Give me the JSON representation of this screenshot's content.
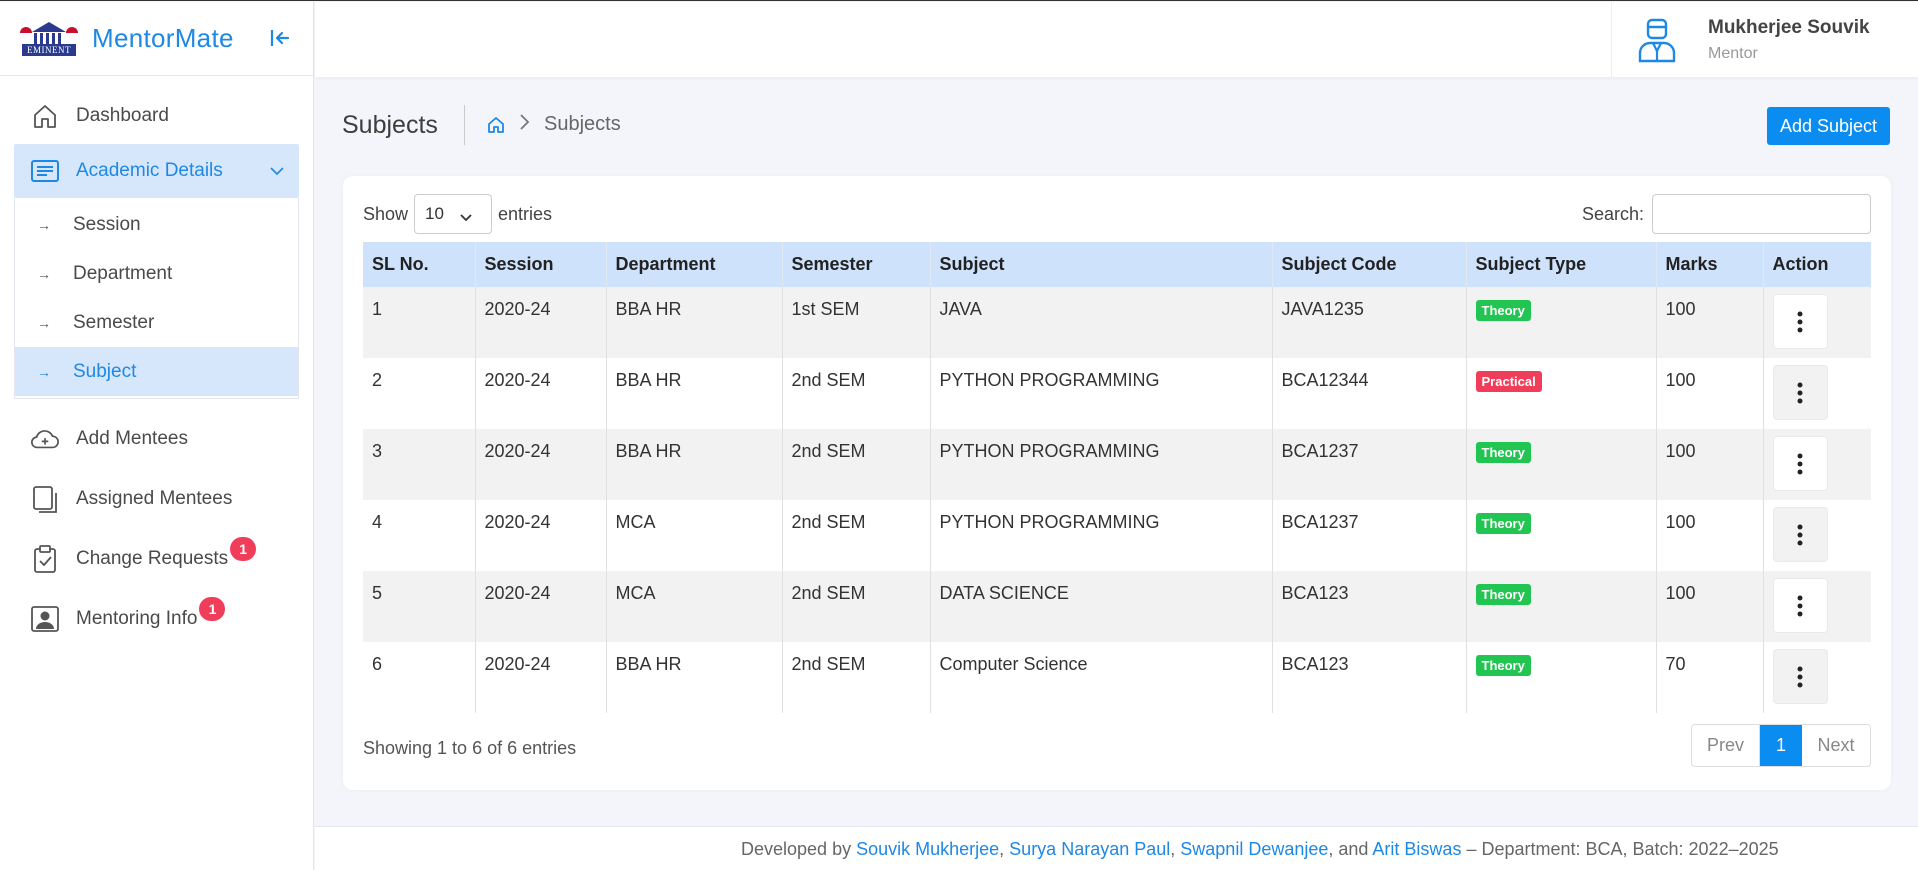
{
  "app": {
    "name": "MentorMate",
    "logo_text": "EMINENT"
  },
  "sidebar": {
    "items": [
      {
        "label": "Dashboard"
      },
      {
        "label": "Academic Details",
        "submenu": [
          {
            "label": "Session"
          },
          {
            "label": "Department"
          },
          {
            "label": "Semester"
          },
          {
            "label": "Subject"
          }
        ]
      },
      {
        "label": "Add Mentees"
      },
      {
        "label": "Assigned Mentees"
      },
      {
        "label": "Change Requests",
        "badge": "1"
      },
      {
        "label": "Mentoring Info",
        "badge": "1"
      }
    ]
  },
  "user": {
    "name": "Mukherjee Souvik",
    "role": "Mentor"
  },
  "page": {
    "title": "Subjects",
    "breadcrumb_current": "Subjects",
    "add_button": "Add Subject"
  },
  "table_controls": {
    "show_label": "Show",
    "entries_value": "10",
    "entries_label": "entries",
    "search_label": "Search:",
    "search_value": ""
  },
  "table": {
    "headers": [
      "SL No.",
      "Session",
      "Department",
      "Semester",
      "Subject",
      "Subject Code",
      "Subject Type",
      "Marks",
      "Action"
    ],
    "rows": [
      {
        "sl": "1",
        "session": "2020-24",
        "department": "BBA HR",
        "semester": "1st SEM",
        "subject": "JAVA",
        "code": "JAVA1235",
        "type": "Theory",
        "marks": "100"
      },
      {
        "sl": "2",
        "session": "2020-24",
        "department": "BBA HR",
        "semester": "2nd SEM",
        "subject": "PYTHON PROGRAMMING",
        "code": "BCA12344",
        "type": "Practical",
        "marks": "100"
      },
      {
        "sl": "3",
        "session": "2020-24",
        "department": "BBA HR",
        "semester": "2nd SEM",
        "subject": "PYTHON PROGRAMMING",
        "code": "BCA1237",
        "type": "Theory",
        "marks": "100"
      },
      {
        "sl": "4",
        "session": "2020-24",
        "department": "MCA",
        "semester": "2nd SEM",
        "subject": "PYTHON PROGRAMMING",
        "code": "BCA1237",
        "type": "Theory",
        "marks": "100"
      },
      {
        "sl": "5",
        "session": "2020-24",
        "department": "MCA",
        "semester": "2nd SEM",
        "subject": "DATA SCIENCE",
        "code": "BCA123",
        "type": "Theory",
        "marks": "100"
      },
      {
        "sl": "6",
        "session": "2020-24",
        "department": "BBA HR",
        "semester": "2nd SEM",
        "subject": "Computer Science",
        "code": "BCA123",
        "type": "Theory",
        "marks": "70"
      }
    ],
    "info": "Showing 1 to 6 of 6 entries"
  },
  "pagination": {
    "prev": "Prev",
    "current": "1",
    "next": "Next"
  },
  "footer": {
    "prefix": "Developed by ",
    "dev1": "Souvik Mukherjee",
    "sep1": ", ",
    "dev2": "Surya Narayan Paul",
    "sep2": ", ",
    "dev3": "Swapnil Dewanjee",
    "sep3": ", and ",
    "dev4": "Arit Biswas",
    "suffix": " – Department: BCA, Batch: 2022–2025"
  },
  "colors": {
    "accent": "#1e88e5",
    "button": "#0b8cf0",
    "theory": "#23c552",
    "practical": "#f03e5a",
    "header_bg": "#cfe2fb"
  }
}
